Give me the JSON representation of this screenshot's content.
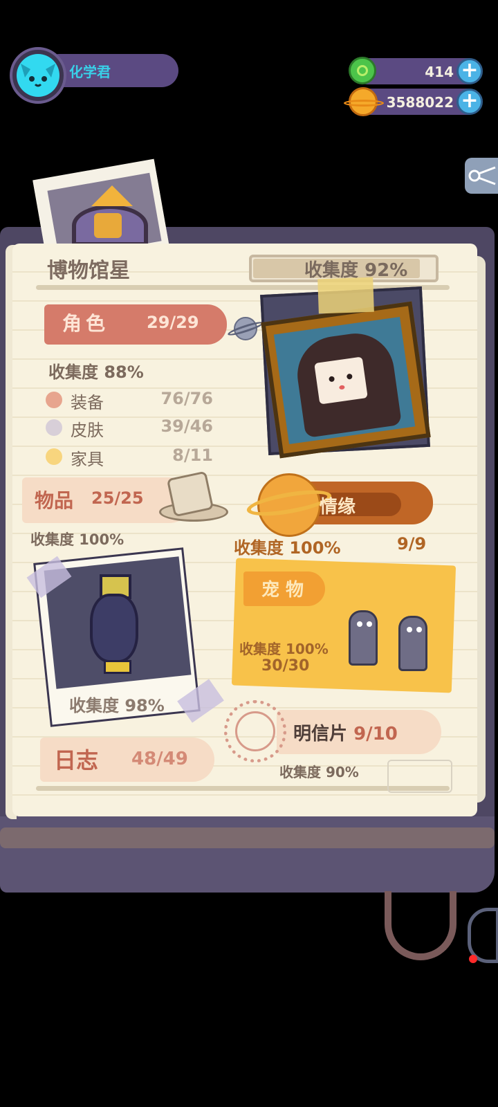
{
  "player": {
    "name": "化学君"
  },
  "currency": {
    "gems": "414",
    "coins": "3588022"
  },
  "book": {
    "title": "博物馆星",
    "collection_label": "收集度",
    "collection_pct": "92%",
    "collection_value": 0.92
  },
  "characters": {
    "label": "角色",
    "count": "29/29",
    "collection": "收集度 88%",
    "subitems": [
      {
        "label": "装备",
        "value": "76/76",
        "color": "#e7a58e"
      },
      {
        "label": "皮肤",
        "value": "39/46",
        "color": "#d8cfd8"
      },
      {
        "label": "家具",
        "value": "8/11",
        "color": "#f8d57e"
      }
    ]
  },
  "items": {
    "label": "物品",
    "count": "25/25",
    "collection": "收集度 100%"
  },
  "relationships": {
    "label": "情缘",
    "collection": "收集度 100%",
    "count": "9/9"
  },
  "artifacts": {
    "collection": "收集度 98%"
  },
  "pets": {
    "label": "宠 物",
    "collection": "收集度 100%",
    "count": "30/30"
  },
  "journal": {
    "label": "日志",
    "count": "48/49"
  },
  "postcards": {
    "label": "明信片",
    "count": "9/10",
    "collection": "收集度 90%"
  },
  "colors": {
    "accent_cyan": "#32d9f0",
    "hud_purple": "#5b4a82",
    "paper": "#f8f2df",
    "character_banner": "#d57b6a",
    "pet_card": "#f8c24a"
  },
  "icons": [
    "cat-avatar-icon",
    "gem-icon",
    "coin-planet-icon",
    "plus-icon",
    "planet-icon",
    "hat-icon",
    "vase-icon",
    "robot-pet-icon",
    "stamp-icon"
  ]
}
